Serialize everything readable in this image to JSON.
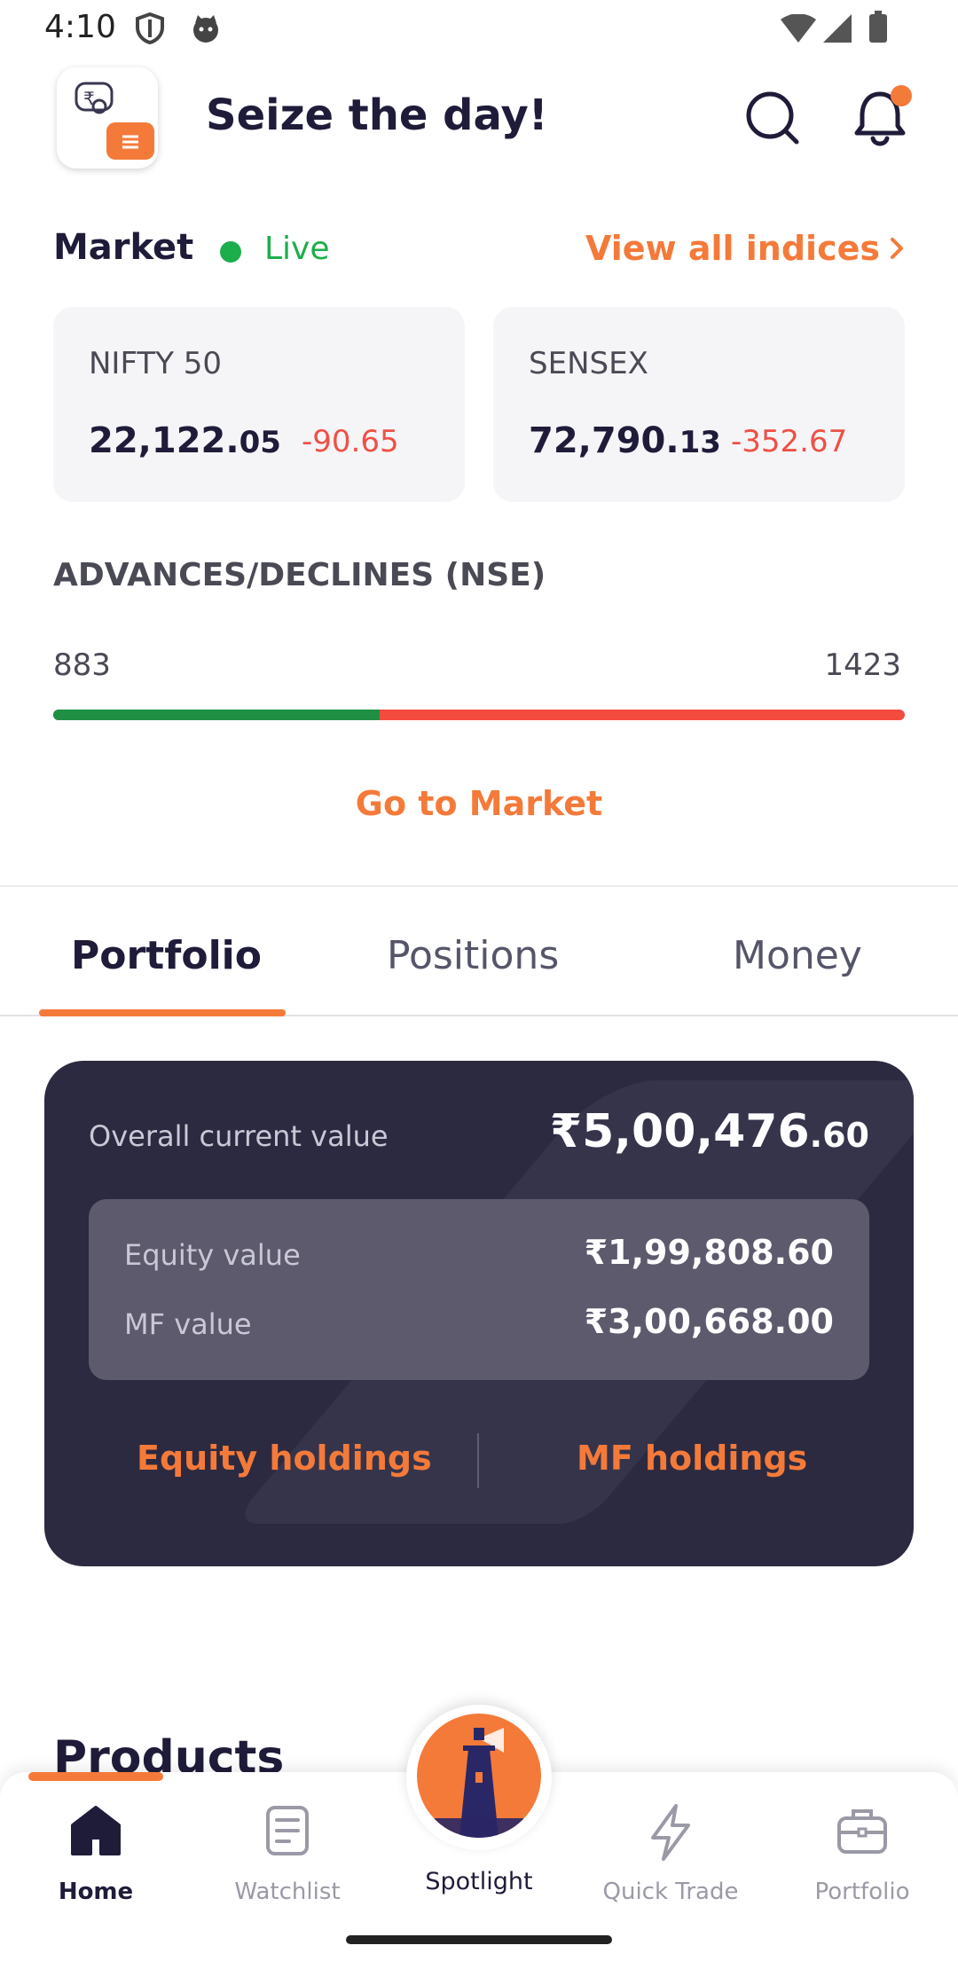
{
  "status_bar": {
    "time": "4:10",
    "icons": [
      "shield-icon",
      "cat-icon",
      "wifi-icon",
      "signal-icon",
      "battery-icon"
    ]
  },
  "header": {
    "title": "Seize the day!",
    "logo_icon": "app-logo-icon",
    "search_icon": "search-icon",
    "bell_icon": "bell-icon",
    "has_notification": true
  },
  "market": {
    "title": "Market",
    "live_label": "Live",
    "view_all_label": "View all indices",
    "indices": [
      {
        "name": "NIFTY 50",
        "value_main": "22,122.",
        "value_dec": "05",
        "change": "-90.65"
      },
      {
        "name": "SENSEX",
        "value_main": "72,790.",
        "value_dec": "13",
        "change": "-352.67"
      }
    ],
    "advances_declines": {
      "title": "ADVANCES/DECLINES (NSE)",
      "advances": "883",
      "declines": "1423",
      "advance_fraction": 0.383
    },
    "go_to_market_label": "Go to Market"
  },
  "tabs": [
    {
      "label": "Portfolio",
      "active": true
    },
    {
      "label": "Positions",
      "active": false
    },
    {
      "label": "Money",
      "active": false
    }
  ],
  "portfolio": {
    "overall_label": "Overall current value",
    "overall_value_main": "₹5,00,476",
    "overall_value_dec": ".60",
    "equity_label": "Equity value",
    "equity_value": "₹1,99,808.60",
    "mf_label": "MF value",
    "mf_value": "₹3,00,668.00",
    "equity_holdings_label": "Equity holdings",
    "mf_holdings_label": "MF holdings"
  },
  "products": {
    "title": "Products"
  },
  "bottom_nav": {
    "items": [
      {
        "label": "Home",
        "icon": "home-icon",
        "active": true
      },
      {
        "label": "Watchlist",
        "icon": "watchlist-icon",
        "active": false
      },
      {
        "label": "Spotlight",
        "icon": "lighthouse-icon",
        "active": false
      },
      {
        "label": "Quick Trade",
        "icon": "lightning-icon",
        "active": false
      },
      {
        "label": "Portfolio",
        "icon": "briefcase-icon",
        "active": false
      }
    ]
  },
  "colors": {
    "accent": "#f47a3a",
    "live_green": "#1cae4b",
    "negative_red": "#ef5046",
    "advance_green": "#1f8f43",
    "card_dark": "#2c2a40"
  }
}
